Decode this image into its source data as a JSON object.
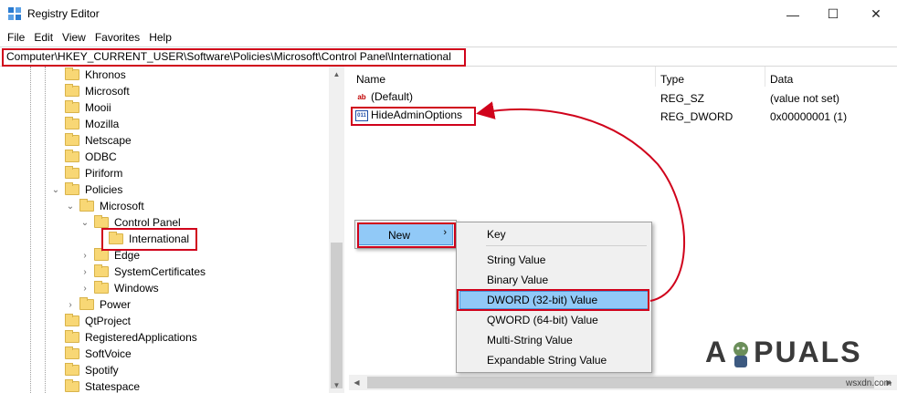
{
  "window": {
    "title": "Registry Editor",
    "minimize": "—",
    "maximize": "☐",
    "close": "✕"
  },
  "menu": [
    "File",
    "Edit",
    "View",
    "Favorites",
    "Help"
  ],
  "address": "Computer\\HKEY_CURRENT_USER\\Software\\Policies\\Microsoft\\Control Panel\\International",
  "tree": [
    {
      "label": "Khronos",
      "chev": ""
    },
    {
      "label": "Microsoft",
      "chev": ""
    },
    {
      "label": "Mooii",
      "chev": ""
    },
    {
      "label": "Mozilla",
      "chev": ""
    },
    {
      "label": "Netscape",
      "chev": ""
    },
    {
      "label": "ODBC",
      "chev": ""
    },
    {
      "label": "Piriform",
      "chev": ""
    },
    {
      "label": "Policies",
      "chev": "⌄"
    },
    {
      "label": "Microsoft",
      "chev": "⌄"
    },
    {
      "label": "Control Panel",
      "chev": "⌄"
    },
    {
      "label": "International",
      "chev": ""
    },
    {
      "label": "Edge",
      "chev": "›"
    },
    {
      "label": "SystemCertificates",
      "chev": "›"
    },
    {
      "label": "Windows",
      "chev": "›"
    },
    {
      "label": "Power",
      "chev": "›"
    },
    {
      "label": "QtProject",
      "chev": ""
    },
    {
      "label": "RegisteredApplications",
      "chev": ""
    },
    {
      "label": "SoftVoice",
      "chev": ""
    },
    {
      "label": "Spotify",
      "chev": ""
    },
    {
      "label": "Statespace",
      "chev": ""
    }
  ],
  "list": {
    "columns": [
      "Name",
      "Type",
      "Data"
    ],
    "rows": [
      {
        "name": "(Default)",
        "type": "REG_SZ",
        "data": "(value not set)",
        "icon": "ab"
      },
      {
        "name": "HideAdminOptions",
        "type": "REG_DWORD",
        "data": "0x00000001 (1)",
        "icon": "011"
      }
    ]
  },
  "context_menu": {
    "new_label": "New",
    "arrow": "›"
  },
  "submenu": [
    "Key",
    "String Value",
    "Binary Value",
    "DWORD (32-bit) Value",
    "QWORD (64-bit) Value",
    "Multi-String Value",
    "Expandable String Value"
  ],
  "watermark": {
    "logo_a": "A",
    "logo_rest": "PUALS",
    "site": "wsxdn.com"
  },
  "colors": {
    "highlight_border": "#d0021b",
    "menu_selected": "#91c9f7",
    "folder": "#f8d775"
  }
}
